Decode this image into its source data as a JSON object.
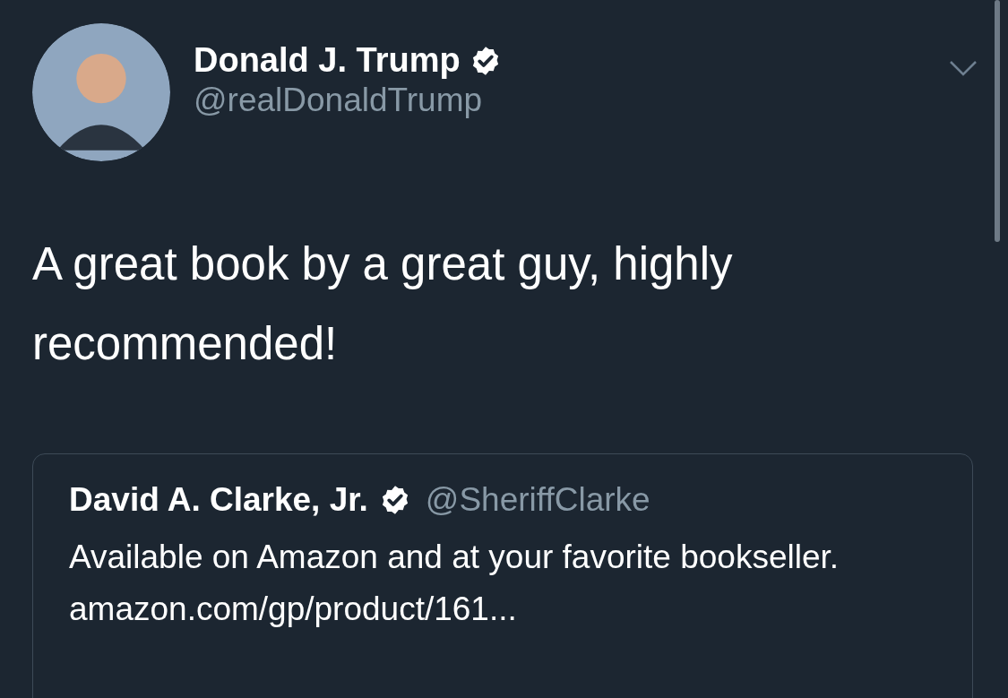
{
  "author": {
    "name": "Donald J. Trump",
    "verified": true,
    "handle": "@realDonaldTrump"
  },
  "tweet": {
    "text": "A great book by a great guy, highly recommended!"
  },
  "quoted_tweet": {
    "author": {
      "name": "David A. Clarke, Jr.",
      "verified": true,
      "handle": "@SheriffClarke"
    },
    "text": "Available on Amazon and at your favorite bookseller.",
    "link": "amazon.com/gp/product/161..."
  }
}
